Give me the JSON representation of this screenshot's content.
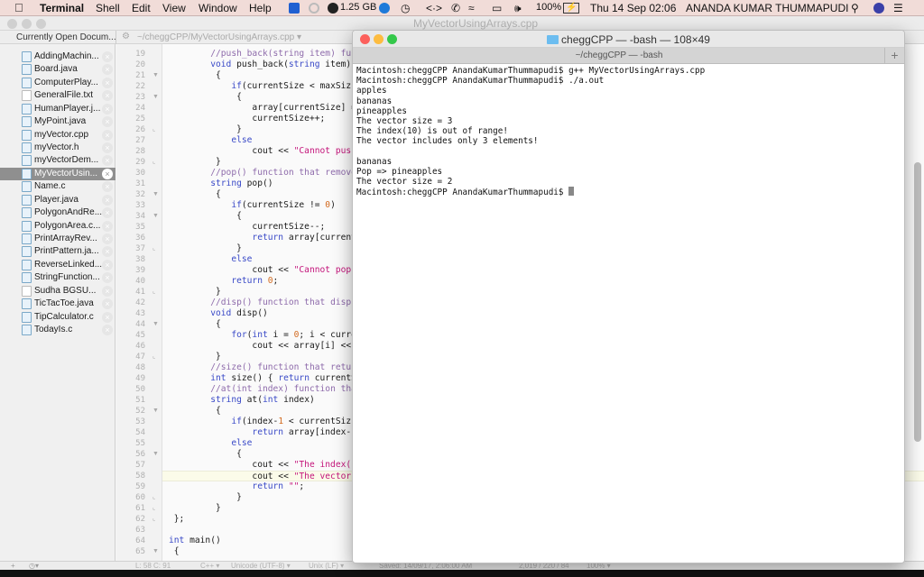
{
  "menubar": {
    "app": "Terminal",
    "items": [
      "Shell",
      "Edit",
      "View",
      "Window",
      "Help"
    ],
    "memory": "1.25 GB",
    "battery": "100%",
    "datetime": "Thu 14 Sep  02:06",
    "user": "ANANDA KUMAR THUMMAPUDI"
  },
  "editor": {
    "title": "MyVectorUsingArrays.cpp",
    "sidebar_header": "Currently Open Docum...",
    "path": "~/cheggCPP/MyVectorUsingArrays.cpp ▾",
    "documents": [
      {
        "name": "AddingMachin...",
        "type": "code"
      },
      {
        "name": "Board.java",
        "type": "code"
      },
      {
        "name": "ComputerPlay...",
        "type": "code"
      },
      {
        "name": "GeneralFile.txt",
        "type": "text"
      },
      {
        "name": "HumanPlayer.j...",
        "type": "code"
      },
      {
        "name": "MyPoint.java",
        "type": "code"
      },
      {
        "name": "myVector.cpp",
        "type": "code"
      },
      {
        "name": "myVector.h",
        "type": "code"
      },
      {
        "name": "myVectorDem...",
        "type": "code"
      },
      {
        "name": "MyVectorUsin...",
        "type": "code",
        "selected": true
      },
      {
        "name": "Name.c",
        "type": "code"
      },
      {
        "name": "Player.java",
        "type": "code"
      },
      {
        "name": "PolygonAndRe...",
        "type": "code"
      },
      {
        "name": "PolygonArea.c...",
        "type": "code"
      },
      {
        "name": "PrintArrayRev...",
        "type": "code"
      },
      {
        "name": "PrintPattern.ja...",
        "type": "code"
      },
      {
        "name": "ReverseLinked...",
        "type": "code"
      },
      {
        "name": "StringFunction...",
        "type": "code"
      },
      {
        "name": "Sudha BGSU...",
        "type": "text"
      },
      {
        "name": "TicTacToe.java",
        "type": "code"
      },
      {
        "name": "TipCalculator.c",
        "type": "code"
      },
      {
        "name": "TodayIs.c",
        "type": "code"
      }
    ],
    "first_line_number": 19,
    "current_line": 58,
    "fold_open_lines": [
      21,
      23,
      32,
      34,
      44,
      52,
      56,
      65
    ],
    "fold_end_lines": [
      26,
      29,
      37,
      41,
      47,
      60,
      61,
      62
    ],
    "code_lines": [
      "        //push_back(string item) fu",
      "        void push_back(string item)",
      "         {",
      "            if(currentSize < maxSiz",
      "             {",
      "                array[currentSize] =",
      "                currentSize++;",
      "             }",
      "            else",
      "                cout << \"Cannot push",
      "         }",
      "        //pop() function that remove",
      "        string pop()",
      "         {",
      "            if(currentSize != 0)",
      "             {",
      "                currentSize--;",
      "                return array[current",
      "             }",
      "            else",
      "                cout << \"Cannot pop",
      "            return 0;",
      "         }",
      "        //disp() function that disp",
      "        void disp()",
      "         {",
      "            for(int i = 0; i < curre",
      "                cout << array[i] <<",
      "         }",
      "        //size() function that retu",
      "        int size() { return currentS",
      "        //at(int index) function tha",
      "        string at(int index)",
      "         {",
      "            if(index-1 < currentSiz",
      "                return array[index-",
      "            else",
      "             {",
      "                cout << \"The index(\"",
      "                cout << \"The vector",
      "                return \"\";",
      "             }",
      "         }",
      " };",
      "",
      "int main()",
      " {"
    ],
    "status": {
      "position": "L: 58 C: 91",
      "language": "C++ ▾",
      "encoding": "Unicode (UTF-8) ▾",
      "line_endings": "Unix (LF) ▾",
      "saved": "Saved: 14/09/17, 2:06:00 AM",
      "counts": "2,019 / 220 / 84",
      "zoom": "100% ▾"
    }
  },
  "terminal": {
    "title": "cheggCPP — -bash — 108×49",
    "tab": "~/cheggCPP — -bash",
    "lines": [
      "Macintosh:cheggCPP AnandaKumarThummapudi$ g++ MyVectorUsingArrays.cpp",
      "Macintosh:cheggCPP AnandaKumarThummapudi$ ./a.out",
      "apples",
      "bananas",
      "pineapples",
      "The vector size = 3",
      "The index(10) is out of range!",
      "The vector includes only 3 elements!",
      "",
      "bananas",
      "Pop => pineapples",
      "The vector size = 2",
      "Macintosh:cheggCPP AnandaKumarThummapudi$ "
    ]
  },
  "colors": {
    "close": "#fc605c",
    "minimize": "#fdbc40",
    "zoom": "#34c84a",
    "keyword": "#3949c7",
    "comment": "#8e6bab",
    "string": "#c4157b",
    "number": "#d2691e"
  }
}
